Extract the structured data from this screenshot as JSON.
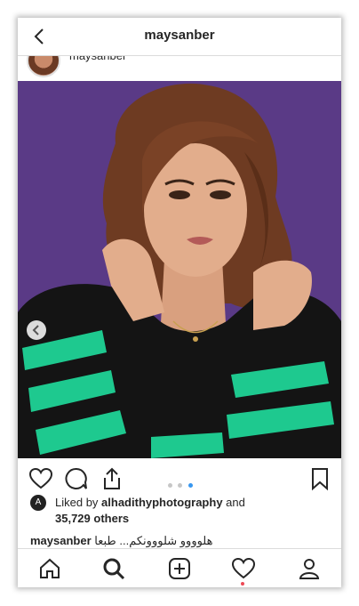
{
  "header": {
    "title": "maysanber"
  },
  "post": {
    "username_partial": "maysanber",
    "carousel": {
      "count": 3,
      "active": 2
    },
    "likes": {
      "prefix": "Liked by",
      "user": "alhadithyphotography",
      "connector": "and",
      "count": "35,729 others",
      "avatar_letter": "A"
    },
    "caption": {
      "user": "maysanber",
      "text": "هلوووو شلووونكم... طبعا"
    }
  },
  "colors": {
    "background": "#5b3b87",
    "stripe": "#1ec98f",
    "active_dot": "#3897f0",
    "notification": "#ed4956"
  },
  "icons": {
    "back": "chevron-left-icon",
    "like": "heart-icon",
    "comment": "comment-icon",
    "share": "share-icon",
    "save": "bookmark-icon",
    "prev": "chevron-left-circle-icon",
    "nav": [
      "home-icon",
      "search-icon",
      "add-post-icon",
      "activity-heart-icon",
      "profile-icon"
    ]
  }
}
